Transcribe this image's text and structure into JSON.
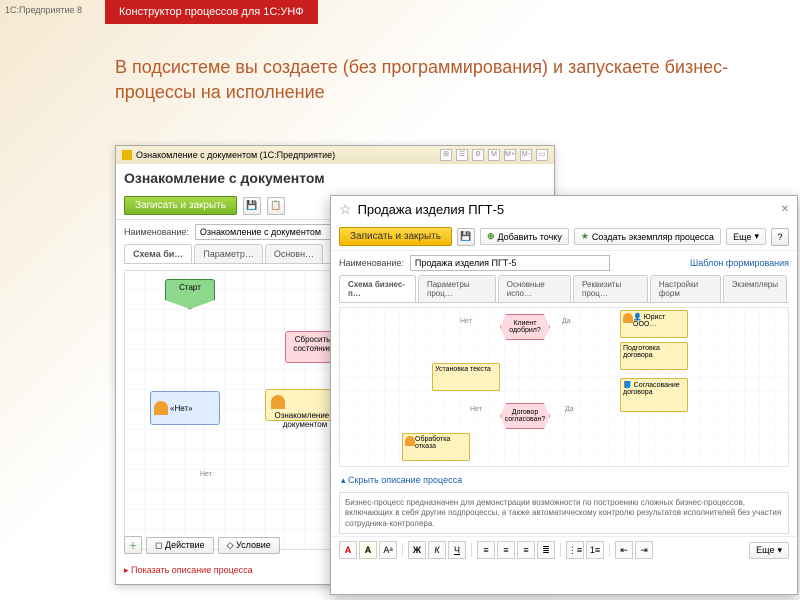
{
  "top_caption": "1С:Предприятие 8",
  "banner": "Конструктор процессов для 1С:УНФ",
  "headline": "В подсистеме вы создаете (без программирования) и запускаете бизнес-процессы на исполнение",
  "win1": {
    "title": "Ознакомление с документом (1С:Предприятие)",
    "header": "Ознакомление с документом",
    "save_close": "Записать и закрыть",
    "name_label": "Наименование:",
    "name_value": "Ознакомление с документом",
    "tabs": [
      "Схема би…",
      "Параметр…",
      "Основн…"
    ],
    "nodes": {
      "start": "Старт",
      "reset": "Сбросить состояние",
      "user": "«Нет»",
      "review": "Ознакомление с документом",
      "no": "Нет"
    },
    "btn_action": "Действие",
    "btn_condition": "Условие",
    "show_desc": "Показать описание процесса"
  },
  "win2": {
    "title": "Продажа изделия ПГТ-5",
    "save_close": "Записать и закрыть",
    "add_point": "Добавить точку",
    "create_instance": "Создать экземпляр процесса",
    "more": "Еще",
    "name_label": "Наименование:",
    "name_value": "Продажа изделия ПГТ-5",
    "template_link": "Шаблон формирования",
    "tabs": [
      "Схема бизнес-п…",
      "Параметры проц…",
      "Основные испо…",
      "Реквизиты проц…",
      "Настройки форм",
      "Экземпляры"
    ],
    "nodes": {
      "client_approved": "Клиент одобрил?",
      "set_text": "Установка текста",
      "contract_ok": "Договор согласован?",
      "reject": "Обработка отказа",
      "lawyer": "Юрист ООО…",
      "prepare": "Подготовка договора",
      "agree": "Согласование договора",
      "yes": "Да",
      "no": "Нет"
    },
    "collapse": "Скрыть описание процесса",
    "description": "Бизнес-процесс предназначен для демонстрации возможности по построению сложных бизнес-процессов, включающих в себя другие подпроцессы, а также автоматическому контролю результатов исполнителей без участия сотрудника-контролера.",
    "rte_more": "Еще"
  }
}
